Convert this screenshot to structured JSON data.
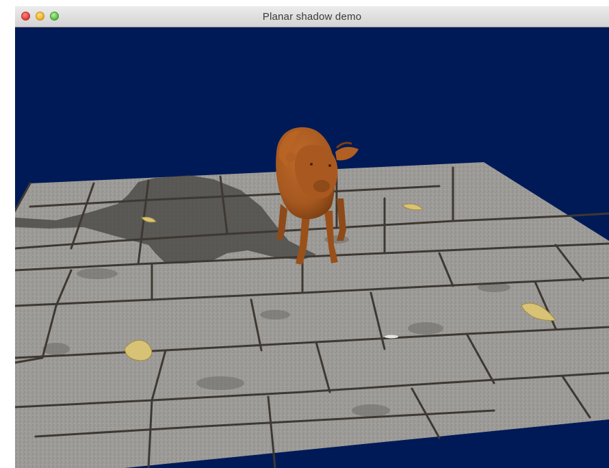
{
  "window": {
    "title": "Planar shadow demo",
    "controls": {
      "close": "close-button",
      "minimize": "minimize-button",
      "zoom": "zoom-button"
    }
  },
  "scene": {
    "background_color": "#001a57",
    "floor_color": "#9c9a96",
    "grout_color": "#3e3832",
    "shadow_color": "#3f3f3c",
    "model_color": "#a5581f",
    "leaf_color": "#d8c276"
  }
}
